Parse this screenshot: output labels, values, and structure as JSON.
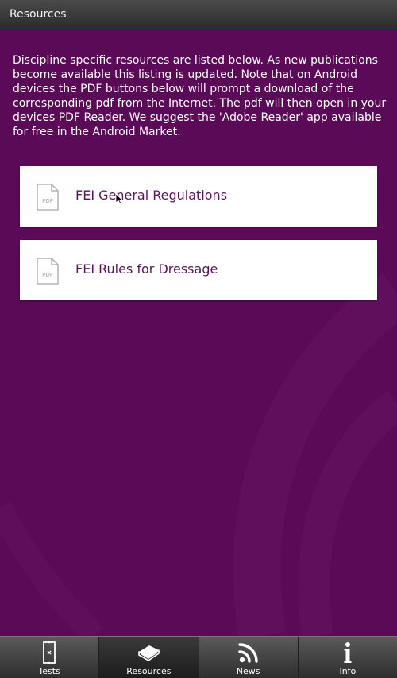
{
  "titlebar": {
    "title": "Resources"
  },
  "intro": {
    "text": "Discipline specific resources are listed below. As new publications become available this listing is updated. Note that on Android devices the PDF buttons below will prompt a download of the corresponding pdf from the Internet. The pdf will then open in your devices PDF Reader. We suggest the 'Adobe Reader' app available for free in the Android Market."
  },
  "resources": [
    {
      "label": "FEI General Regulations",
      "icon": "pdf-file-icon",
      "icon_text": "PDF"
    },
    {
      "label": "FEI Rules for Dressage",
      "icon": "pdf-file-icon",
      "icon_text": "PDF"
    }
  ],
  "tabs": [
    {
      "label": "Tests",
      "icon": "arena-icon",
      "active": false
    },
    {
      "label": "Resources",
      "icon": "book-icon",
      "active": true
    },
    {
      "label": "News",
      "icon": "rss-icon",
      "active": false
    },
    {
      "label": "Info",
      "icon": "info-icon",
      "active": false
    }
  ],
  "colors": {
    "background": "#5b0a57",
    "card_text": "#5a145a",
    "titlebar": "#3a3a3a"
  }
}
